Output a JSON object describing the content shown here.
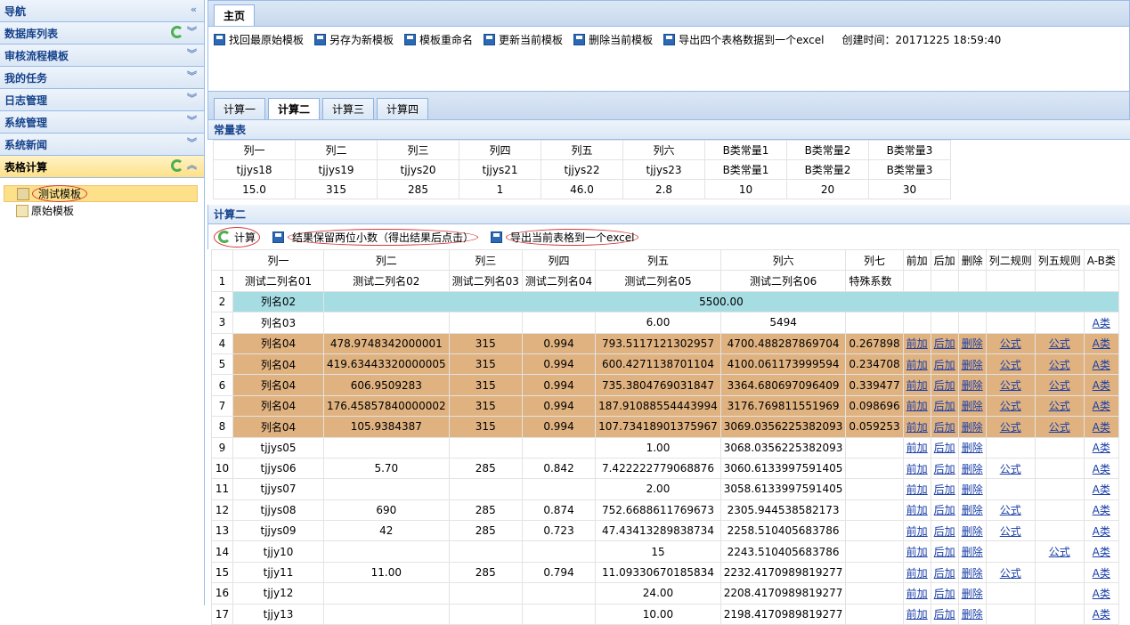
{
  "nav": {
    "title": "导航",
    "collapse_icon": "«",
    "sections": [
      {
        "label": "数据库列表",
        "tools": "refresh-chevron"
      },
      {
        "label": "审核流程模板"
      },
      {
        "label": "我的任务"
      },
      {
        "label": "日志管理"
      },
      {
        "label": "系统管理"
      },
      {
        "label": "系统新闻"
      },
      {
        "label": "表格计算",
        "active": true
      }
    ],
    "tree": [
      {
        "label": "测试模板",
        "selected": true
      },
      {
        "label": "原始模板"
      }
    ]
  },
  "main": {
    "tab": "主页",
    "toolbar": [
      "找回最原始模板",
      "另存为新模板",
      "模板重命名",
      "更新当前模板",
      "删除当前模板",
      "导出四个表格数据到一个excel"
    ],
    "created": "创建时间：20171225 18:59:40",
    "subtabs": [
      "计算一",
      "计算二",
      "计算三",
      "计算四"
    ],
    "active_subtab": "计算二"
  },
  "constants": {
    "title": "常量表",
    "headers": [
      "列一",
      "列二",
      "列三",
      "列四",
      "列五",
      "列六",
      "B类常量1",
      "B类常量2",
      "B类常量3"
    ],
    "row1": [
      "tjjys18",
      "tjjys19",
      "tjjys20",
      "tjjys21",
      "tjjys22",
      "tjjys23",
      "B类常量1",
      "B类常量2",
      "B类常量3"
    ],
    "row2": [
      "15.0",
      "315",
      "285",
      "1",
      "46.0",
      "2.8",
      "10",
      "20",
      "30"
    ]
  },
  "calc": {
    "title": "计算二",
    "toolbar": {
      "calc": "计算",
      "round": "结果保留两位小数（得出结果后点击）",
      "export": "导出当前表格到一个excel"
    },
    "headers": [
      "",
      "列一",
      "列二",
      "列三",
      "列四",
      "列五",
      "列六",
      "列七",
      "前加",
      "后加",
      "删除",
      "列二规则",
      "列五规则",
      "A-B类"
    ],
    "rows": [
      {
        "n": "1",
        "c": [
          "测试二列名01",
          "测试二列名02",
          "测试二列名03",
          "测试二列名04",
          "测试二列名05",
          "测试二列名06",
          "特殊系数",
          "",
          "",
          "",
          "",
          "",
          ""
        ],
        "type": "plain"
      },
      {
        "n": "2",
        "c": [
          "列名02",
          "",
          "",
          "",
          "",
          "5500.00",
          "",
          "",
          "",
          "",
          "",
          "",
          ""
        ],
        "type": "teal"
      },
      {
        "n": "3",
        "c": [
          "列名03",
          "",
          "",
          "",
          "6.00",
          "5494",
          "",
          "",
          "",
          "",
          "",
          "",
          "A类"
        ],
        "type": "plain"
      },
      {
        "n": "4",
        "c": [
          "列名04",
          "478.9748342000001",
          "315",
          "0.994",
          "793.5117121302957",
          "4700.488287869704",
          "0.267898",
          "前加",
          "后加",
          "删除",
          "公式",
          "公式",
          "A类"
        ],
        "type": "orange"
      },
      {
        "n": "5",
        "c": [
          "列名04",
          "419.63443320000005",
          "315",
          "0.994",
          "600.4271138701104",
          "4100.061173999594",
          "0.234708",
          "前加",
          "后加",
          "删除",
          "公式",
          "公式",
          "A类"
        ],
        "type": "orange"
      },
      {
        "n": "6",
        "c": [
          "列名04",
          "606.9509283",
          "315",
          "0.994",
          "735.3804769031847",
          "3364.680697096409",
          "0.339477",
          "前加",
          "后加",
          "删除",
          "公式",
          "公式",
          "A类"
        ],
        "type": "orange"
      },
      {
        "n": "7",
        "c": [
          "列名04",
          "176.45857840000002",
          "315",
          "0.994",
          "187.91088554443994",
          "3176.769811551969",
          "0.098696",
          "前加",
          "后加",
          "删除",
          "公式",
          "公式",
          "A类"
        ],
        "type": "orange"
      },
      {
        "n": "8",
        "c": [
          "列名04",
          "105.9384387",
          "315",
          "0.994",
          "107.73418901375967",
          "3069.0356225382093",
          "0.059253",
          "前加",
          "后加",
          "删除",
          "公式",
          "公式",
          "A类"
        ],
        "type": "orange"
      },
      {
        "n": "9",
        "c": [
          "tjjys05",
          "",
          "",
          "",
          "1.00",
          "3068.0356225382093",
          "",
          "前加",
          "后加",
          "删除",
          "",
          "",
          "A类"
        ],
        "type": "plain"
      },
      {
        "n": "10",
        "c": [
          "tjjys06",
          "5.70",
          "285",
          "0.842",
          "7.422222779068876",
          "3060.6133997591405",
          "",
          "前加",
          "后加",
          "删除",
          "公式",
          "",
          "A类"
        ],
        "type": "plain"
      },
      {
        "n": "11",
        "c": [
          "tjjys07",
          "",
          "",
          "",
          "2.00",
          "3058.6133997591405",
          "",
          "前加",
          "后加",
          "删除",
          "",
          "",
          "A类"
        ],
        "type": "plain"
      },
      {
        "n": "12",
        "c": [
          "tjjys08",
          "690",
          "285",
          "0.874",
          "752.6688611769673",
          "2305.944538582173",
          "",
          "前加",
          "后加",
          "删除",
          "公式",
          "",
          "A类"
        ],
        "type": "plain"
      },
      {
        "n": "13",
        "c": [
          "tjjys09",
          "42",
          "285",
          "0.723",
          "47.43413289838734",
          "2258.510405683786",
          "",
          "前加",
          "后加",
          "删除",
          "公式",
          "",
          "A类"
        ],
        "type": "plain"
      },
      {
        "n": "14",
        "c": [
          "tjjy10",
          "",
          "",
          "",
          "15",
          "2243.510405683786",
          "",
          "前加",
          "后加",
          "删除",
          "",
          "公式",
          "A类"
        ],
        "type": "plain"
      },
      {
        "n": "15",
        "c": [
          "tjjy11",
          "11.00",
          "285",
          "0.794",
          "11.09330670185834",
          "2232.4170989819277",
          "",
          "前加",
          "后加",
          "删除",
          "公式",
          "",
          "A类"
        ],
        "type": "plain"
      },
      {
        "n": "16",
        "c": [
          "tjjy12",
          "",
          "",
          "",
          "24.00",
          "2208.4170989819277",
          "",
          "前加",
          "后加",
          "删除",
          "",
          "",
          "A类"
        ],
        "type": "plain"
      },
      {
        "n": "17",
        "c": [
          "tjjy13",
          "",
          "",
          "",
          "10.00",
          "2198.4170989819277",
          "",
          "前加",
          "后加",
          "删除",
          "",
          "",
          "A类"
        ],
        "type": "plain"
      }
    ]
  }
}
